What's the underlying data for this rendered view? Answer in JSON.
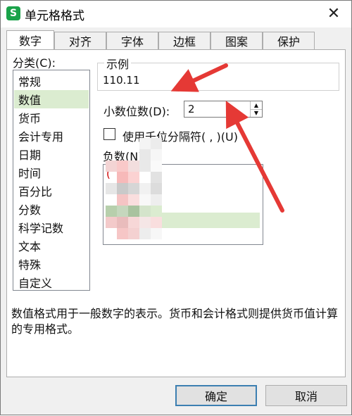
{
  "window": {
    "title": "单元格格式",
    "app_icon": "S",
    "close": "✕"
  },
  "tabs": [
    {
      "label": "数字",
      "active": true
    },
    {
      "label": "对齐",
      "active": false
    },
    {
      "label": "字体",
      "active": false
    },
    {
      "label": "边框",
      "active": false
    },
    {
      "label": "图案",
      "active": false
    },
    {
      "label": "保护",
      "active": false
    }
  ],
  "category": {
    "label": "分类(C):",
    "items": [
      "常规",
      "数值",
      "货币",
      "会计专用",
      "日期",
      "时间",
      "百分比",
      "分数",
      "科学记数",
      "文本",
      "特殊",
      "自定义"
    ],
    "selected": "数值"
  },
  "sample": {
    "legend": "示例",
    "value": "110.11"
  },
  "decimals": {
    "label": "小数位数(D):",
    "value": "2"
  },
  "thousands": {
    "label": "使用千位分隔符( , )(U)",
    "checked": false
  },
  "negative": {
    "label": "负数(N)",
    "items": [
      "(",
      "(",
      "",
      "",
      ""
    ]
  },
  "description": "数值格式用于一般数字的表示。货币和会计格式则提供货币值计算的专用格式。",
  "buttons": {
    "ok": "确定",
    "cancel": "取消"
  },
  "colors": {
    "selection": "#dbecd0",
    "arrow": "#e53935",
    "accent": "#3c7fb1",
    "negative_text": "#d00000"
  }
}
